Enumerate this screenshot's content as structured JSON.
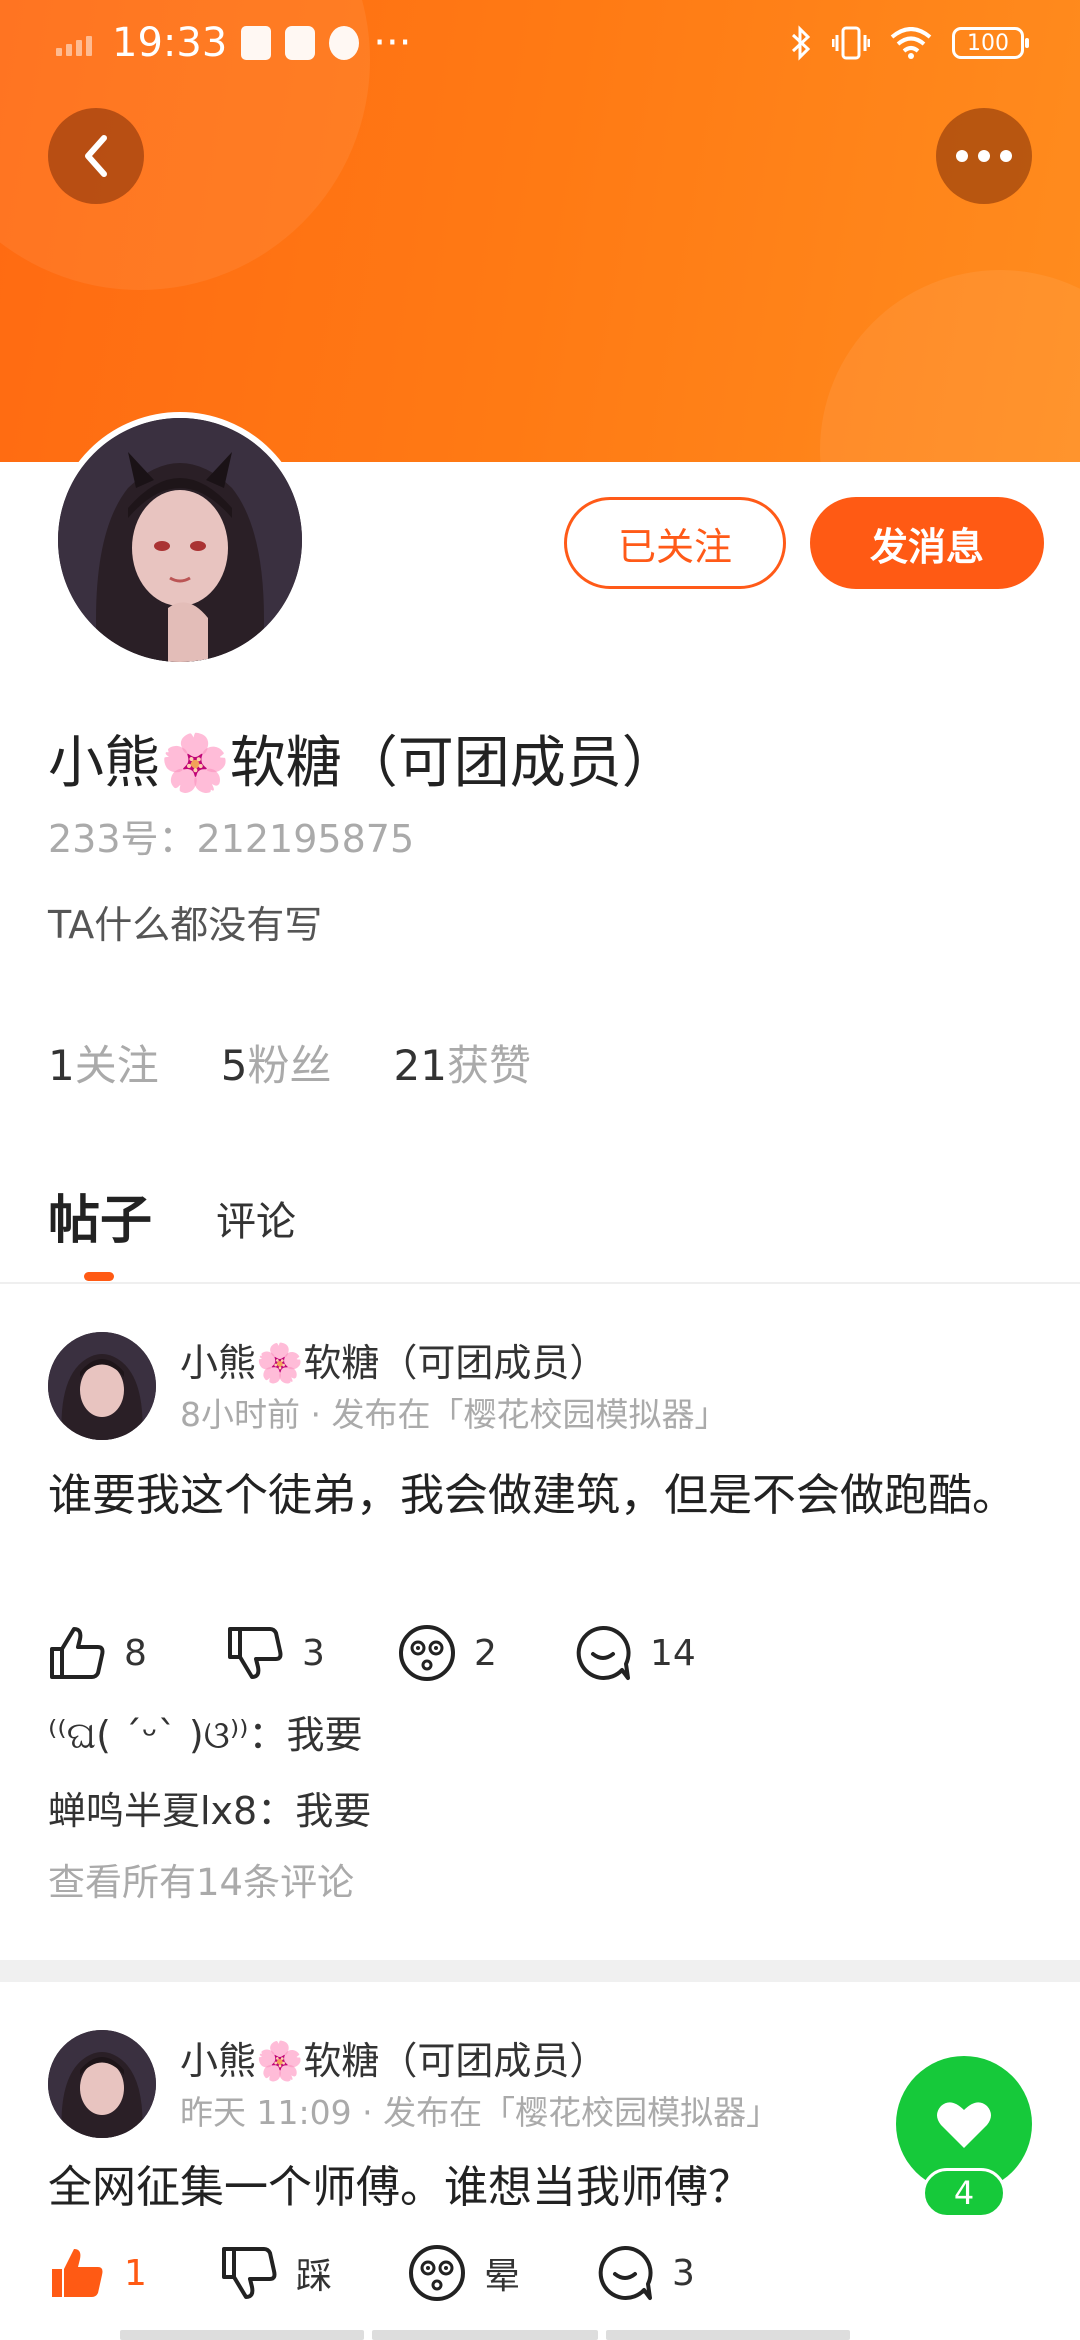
{
  "status_bar": {
    "time": "19:33",
    "more": "···",
    "battery": "100"
  },
  "header": {
    "back_icon": "chevron-left-icon",
    "more_icon": "more-dots-icon",
    "accent_color": "#ff6a12"
  },
  "profile": {
    "name": "小熊🌸软糖（可团成员）",
    "id_label": "233号：",
    "id_value": "212195875",
    "bio": "TA什么都没有写",
    "follow_label": "已关注",
    "message_label": "发消息",
    "stats": [
      {
        "num": "1",
        "label": "关注"
      },
      {
        "num": "5",
        "label": "粉丝"
      },
      {
        "num": "21",
        "label": "获赞"
      }
    ]
  },
  "tabs": {
    "posts": "帖子",
    "comments": "评论"
  },
  "posts": [
    {
      "author": "小熊🌸软糖（可团成员）",
      "time": "8小时前",
      "sep": "·",
      "published_in": "发布在「樱花校园模拟器」",
      "body": "谁要我这个徒弟，我会做建筑，但是不会做跑酷。",
      "likes": "8",
      "dislikes": "3",
      "dizzy": "2",
      "comments": "14",
      "replies": [
        {
          "user": "⁽⁽ଘ( ˊᵕˋ )ଓ⁾⁾",
          "text": "：我要"
        },
        {
          "user": "蝉鸣半夏lx8",
          "text": "：我要"
        }
      ],
      "see_all": "查看所有14条评论"
    },
    {
      "author": "小熊🌸软糖（可团成员）",
      "time": "昨天 11:09",
      "sep": "·",
      "published_in": "发布在「樱花校园模拟器」",
      "body": "全网征集一个师傅。谁想当我师傅？",
      "likes": "1",
      "dislike_label": "踩",
      "dizzy_label": "晕",
      "comments": "3"
    }
  ],
  "fab": {
    "icon": "heart-icon",
    "count": "4",
    "color": "#16c93a"
  }
}
